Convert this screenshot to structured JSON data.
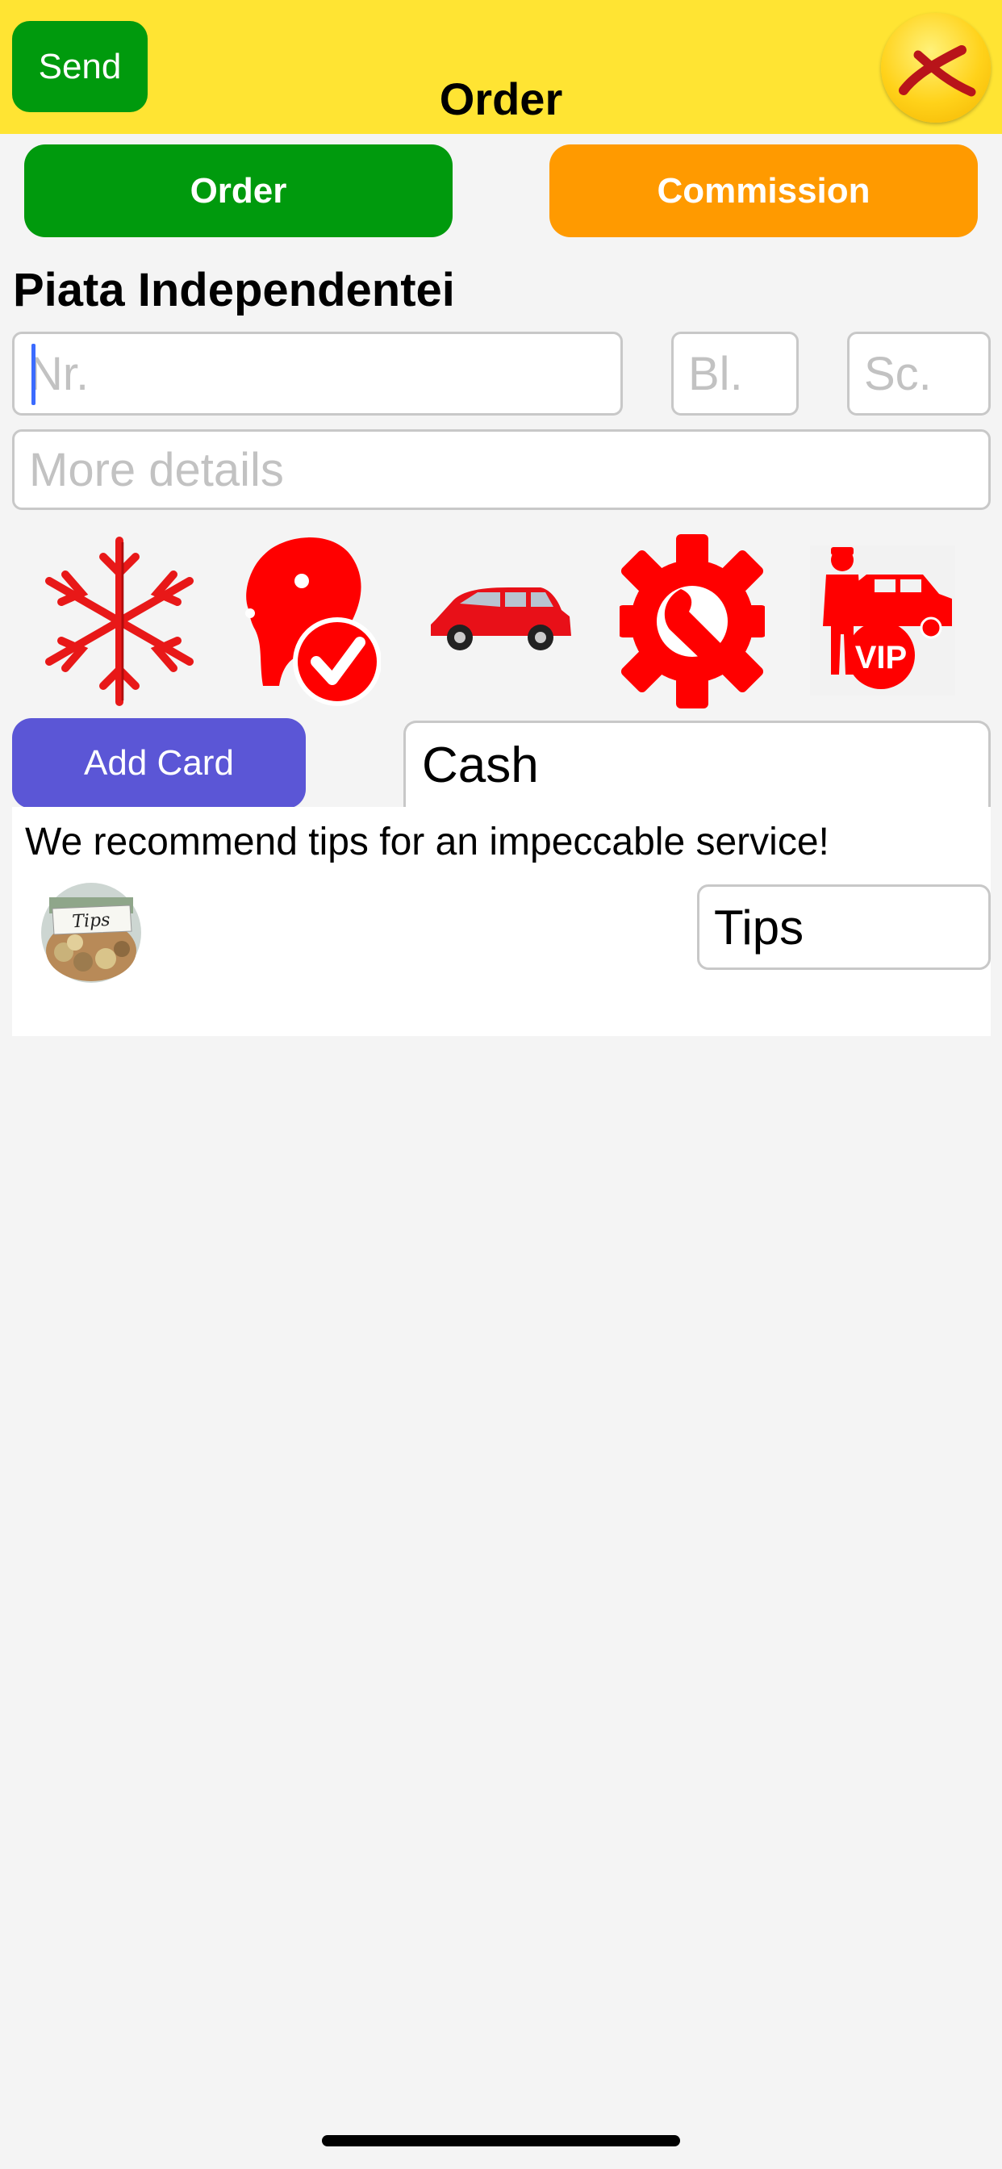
{
  "header": {
    "send_label": "Send",
    "title": "Order",
    "close_icon": "close-x-icon"
  },
  "modes": {
    "order_label": "Order",
    "commission_label": "Commission"
  },
  "address": {
    "street": "Piata Independentei",
    "nr_placeholder": "Nr.",
    "bl_placeholder": "Bl.",
    "sc_placeholder": "Sc.",
    "details_placeholder": "More details"
  },
  "options": [
    {
      "icon": "snowflake-icon",
      "meaning": "air conditioning"
    },
    {
      "icon": "pet-friendly-icon",
      "meaning": "pets allowed"
    },
    {
      "icon": "car-icon",
      "meaning": "large car"
    },
    {
      "icon": "gear-wrench-icon",
      "meaning": "service"
    },
    {
      "icon": "vip-driver-icon",
      "meaning": "VIP"
    }
  ],
  "payment": {
    "add_card_label": "Add Card",
    "method": "Cash"
  },
  "tips": {
    "note": "We recommend tips for an impeccable service!",
    "jar_label": "Tips",
    "field_value": "Tips"
  },
  "colors": {
    "header_bg": "#ffe433",
    "green": "#009a0d",
    "orange": "#ff9a00",
    "purple": "#5b56d6",
    "icon_red": "#ff0000"
  }
}
